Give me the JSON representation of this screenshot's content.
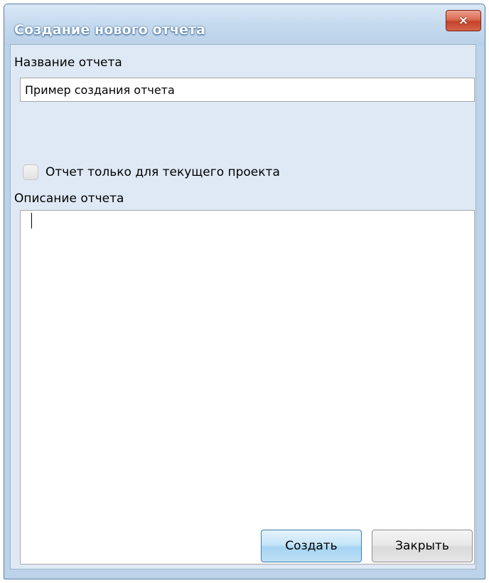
{
  "window": {
    "title": "Создание нового отчета",
    "close_icon": "×"
  },
  "form": {
    "name_label": "Название отчета",
    "name_value": "Пример создания отчета",
    "checkbox_label": "Отчет только для текущего проекта",
    "checkbox_checked": false,
    "description_label": "Описание отчета",
    "description_value": ""
  },
  "buttons": {
    "create_label": "Создать",
    "close_label": "Закрыть"
  },
  "icons": {
    "close": "close-icon"
  },
  "colors": {
    "title_bar": "#c7dbef",
    "close_button": "#db6a52",
    "create_button": "#c6e5f8",
    "dialog_background": "#dfe9f5"
  }
}
